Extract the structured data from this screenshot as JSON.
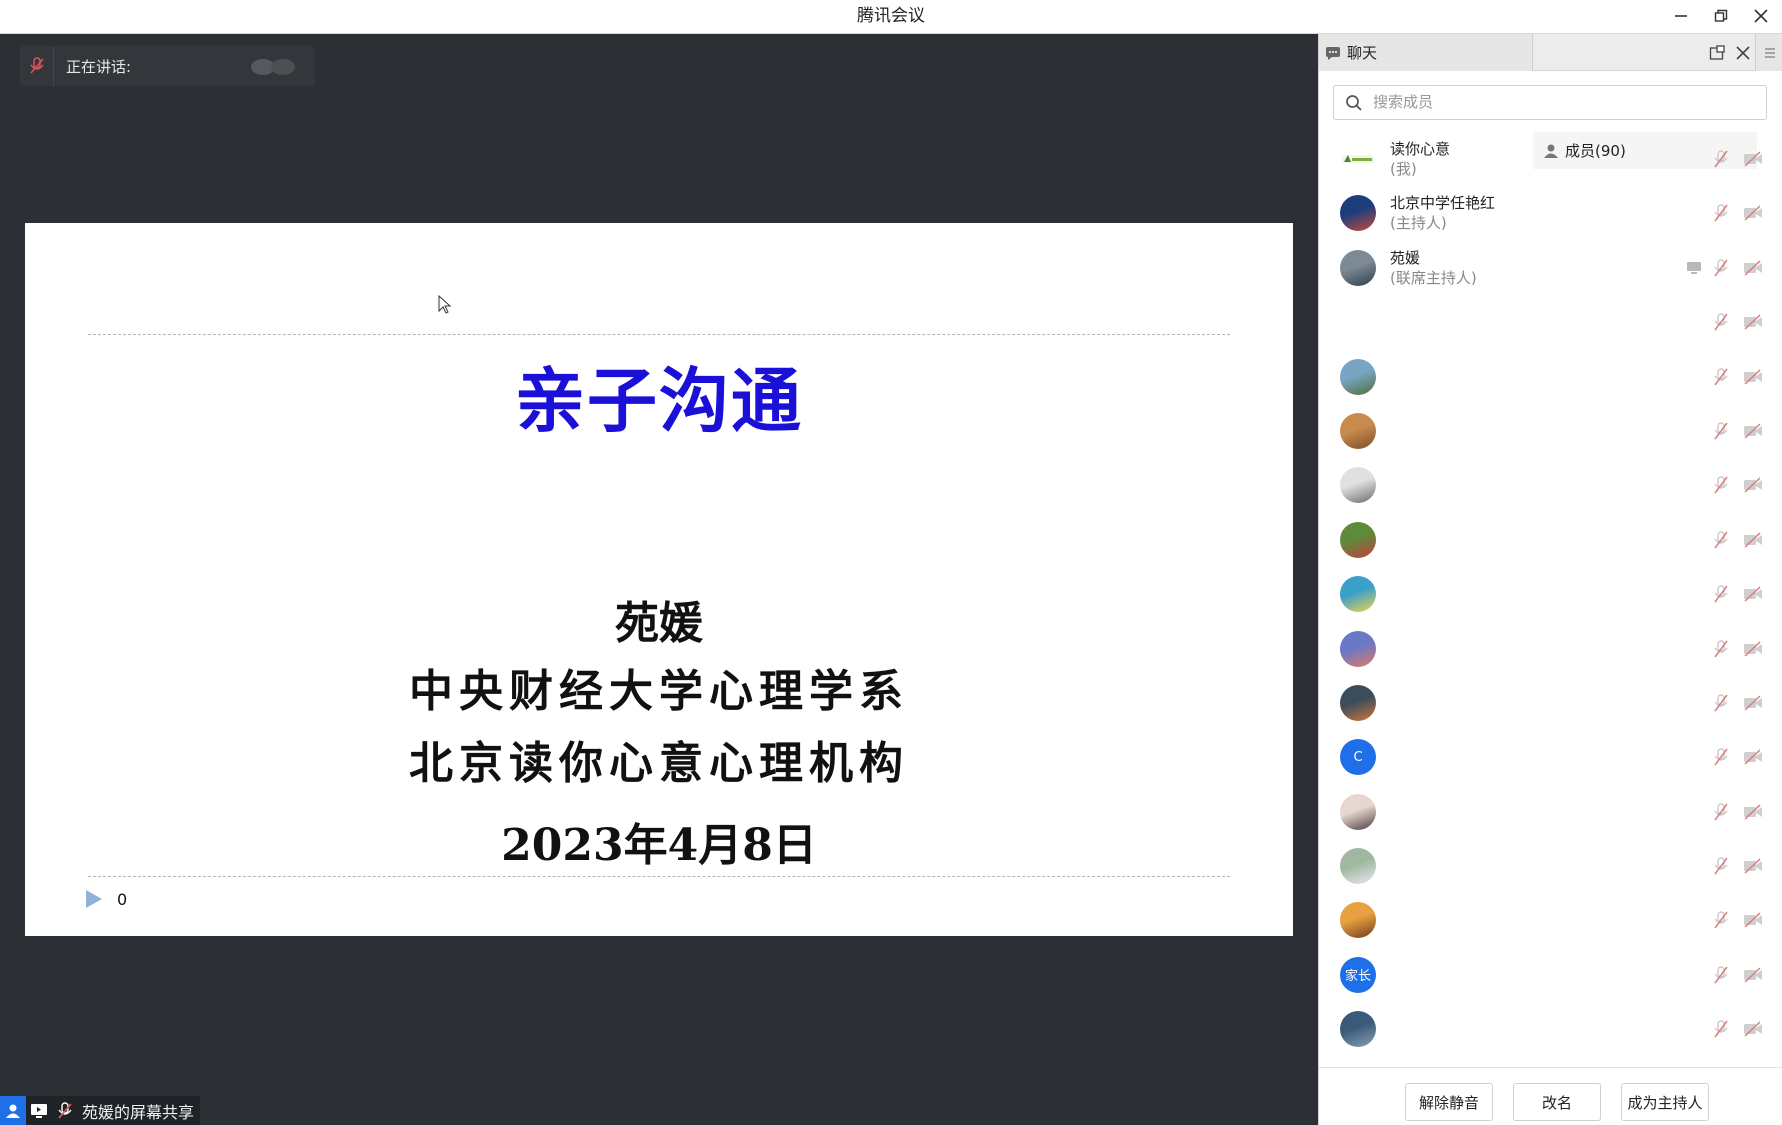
{
  "window": {
    "title": "腾讯会议"
  },
  "speaking": {
    "label": "正在讲话:"
  },
  "slide": {
    "title": "亲子沟通",
    "author": "苑媛",
    "affiliation1": "中央财经大学心理学系",
    "affiliation2": "北京读你心意心理机构",
    "date": "2023年4月8日",
    "counter": "0",
    "title_color": "#1a10d8"
  },
  "sharebar": {
    "label": "苑媛的屏幕共享"
  },
  "panel": {
    "tab_chat": "聊天",
    "tab_members": "成员(90)",
    "search_placeholder": "搜索成员",
    "members": [
      {
        "name": "读你心意",
        "role": "(我)",
        "avatar": "logo"
      },
      {
        "name": "北京中学任艳红",
        "role": "(主持人)",
        "avatar": "photo-1"
      },
      {
        "name": "苑媛",
        "role": "(联席主持人)",
        "avatar": "photo-2",
        "sharing": true
      },
      {
        "name": "",
        "role": "",
        "avatar": "blank"
      },
      {
        "name": "",
        "role": "",
        "avatar": "photo-3"
      },
      {
        "name": "",
        "role": "",
        "avatar": "photo-4"
      },
      {
        "name": "",
        "role": "",
        "avatar": "photo-5"
      },
      {
        "name": "",
        "role": "",
        "avatar": "photo-6"
      },
      {
        "name": "",
        "role": "",
        "avatar": "photo-7"
      },
      {
        "name": "",
        "role": "",
        "avatar": "photo-8"
      },
      {
        "name": "",
        "role": "",
        "avatar": "photo-9"
      },
      {
        "name": "",
        "role": "",
        "avatar": "letter",
        "letter": "C"
      },
      {
        "name": "",
        "role": "",
        "avatar": "photo-10"
      },
      {
        "name": "",
        "role": "",
        "avatar": "photo-11"
      },
      {
        "name": "",
        "role": "",
        "avatar": "photo-12"
      },
      {
        "name": "",
        "role": "",
        "avatar": "letter",
        "letter": "家长"
      },
      {
        "name": "",
        "role": "",
        "avatar": "photo-13"
      }
    ],
    "buttons": {
      "unmute": "解除静音",
      "rename": "改名",
      "make_host": "成为主持人"
    }
  },
  "colors": {
    "accent": "#1e6fe8",
    "stage_bg": "#2c2f33",
    "muted_red": "#e06060"
  }
}
